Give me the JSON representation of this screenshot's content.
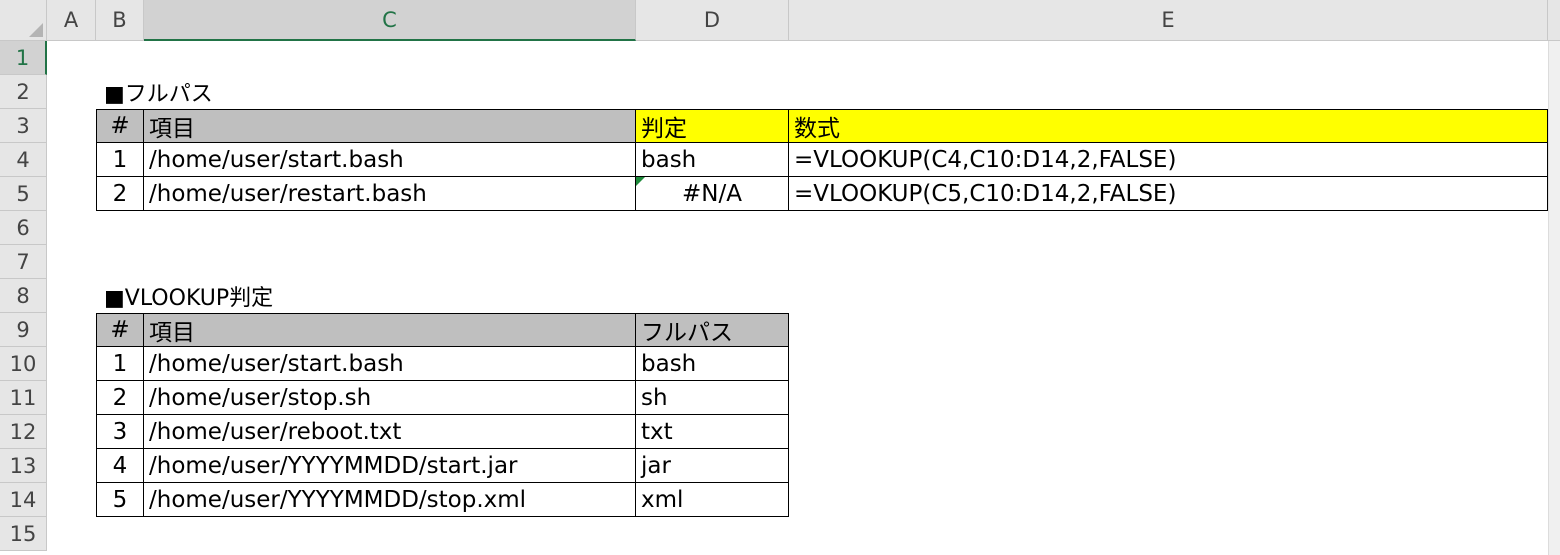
{
  "columns": [
    "A",
    "B",
    "C",
    "D",
    "E"
  ],
  "rows": [
    "1",
    "2",
    "3",
    "4",
    "5",
    "6",
    "7",
    "8",
    "9",
    "10",
    "11",
    "12",
    "13",
    "14",
    "15"
  ],
  "section1": {
    "title": "■フルパス",
    "headers": [
      "#",
      "項目",
      "判定",
      "数式"
    ],
    "rows": [
      {
        "num": "1",
        "item": "/home/user/start.bash",
        "result": "bash",
        "formula": "=VLOOKUP(C4,C10:D14,2,FALSE)"
      },
      {
        "num": "2",
        "item": "/home/user/restart.bash",
        "result": "#N/A",
        "formula": "=VLOOKUP(C5,C10:D14,2,FALSE)"
      }
    ]
  },
  "section2": {
    "title": "■VLOOKUP判定",
    "headers": [
      "#",
      "項目",
      "フルパス"
    ],
    "rows": [
      {
        "num": "1",
        "item": "/home/user/start.bash",
        "ext": "bash"
      },
      {
        "num": "2",
        "item": "/home/user/stop.sh",
        "ext": "sh"
      },
      {
        "num": "3",
        "item": "/home/user/reboot.txt",
        "ext": "txt"
      },
      {
        "num": "4",
        "item": "/home/user/YYYYMMDD/start.jar",
        "ext": "jar"
      },
      {
        "num": "5",
        "item": "/home/user/YYYYMMDD/stop.xml",
        "ext": "xml"
      }
    ]
  },
  "colors": {
    "header_gray": "#bfbfbf",
    "highlight_yellow": "#ffff00",
    "active_green": "#217346"
  }
}
